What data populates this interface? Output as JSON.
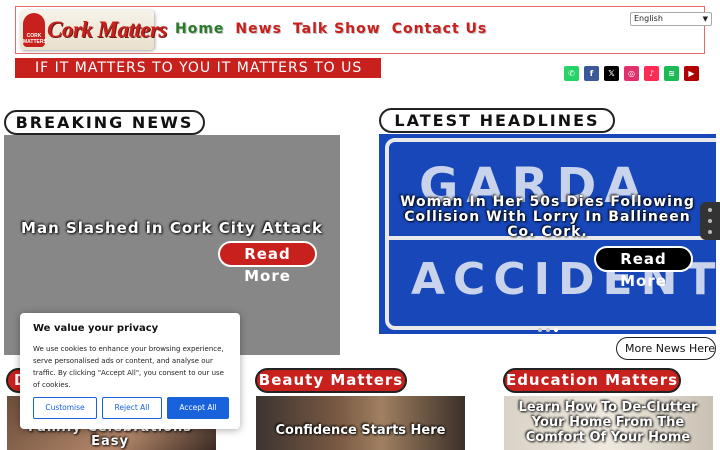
{
  "header": {
    "logo": {
      "text": "Cork Matters",
      "badge_text": "CORK MATTERS"
    },
    "nav": [
      {
        "label": "Home",
        "color": "#2a7a2a"
      },
      {
        "label": "News",
        "color": "#c8201d"
      },
      {
        "label": "Talk Show",
        "color": "#c8201d"
      },
      {
        "label": "Contact Us",
        "color": "#c8201d"
      }
    ],
    "language": {
      "selected": "English"
    }
  },
  "tagline": "IF IT MATTERS TO YOU IT MATTERS TO US",
  "social": [
    {
      "icon": "whatsapp-icon",
      "glyph": "✆",
      "color": "#25d366"
    },
    {
      "icon": "facebook-icon",
      "glyph": "f",
      "color": "#3b5998"
    },
    {
      "icon": "x-icon",
      "glyph": "𝕏",
      "color": "#000000"
    },
    {
      "icon": "instagram-icon",
      "glyph": "◎",
      "color": "#e1306c"
    },
    {
      "icon": "tiktok-icon",
      "glyph": "♪",
      "color": "#fe2c55"
    },
    {
      "icon": "spotify-icon",
      "glyph": "≋",
      "color": "#1db954"
    },
    {
      "icon": "youtube-icon",
      "glyph": "▶",
      "color": "#b00000"
    }
  ],
  "breaking": {
    "heading": "BREAKING NEWS",
    "story_title": "Man Slashed in Cork City Attack",
    "read_more": "Read More"
  },
  "headlines": {
    "heading": "LATEST HEADLINES",
    "sign_top": "GARDA",
    "sign_bottom": "ACCIDENT",
    "story_title": "Woman In Her 50s Dies Following Collision With Lorry In Ballineen Co. Cork.",
    "read_more": "Read More",
    "more_news": "More News Here"
  },
  "sections": [
    {
      "heading": "D",
      "card_title": "Family Celebrations Easy"
    },
    {
      "heading": "Beauty Matters",
      "card_title": "Confidence Starts Here"
    },
    {
      "heading": "Education Matters",
      "card_title": "Learn How To De-Clutter Your Home From The Comfort Of Your Home"
    }
  ],
  "cookie": {
    "title": "We value your privacy",
    "body": "We use cookies to enhance your browsing experience, serve personalised ads or content, and analyse our traffic. By clicking \"Accept All\", you consent to our use of cookies.",
    "customise": "Customise",
    "reject": "Reject All",
    "accept": "Accept All"
  }
}
